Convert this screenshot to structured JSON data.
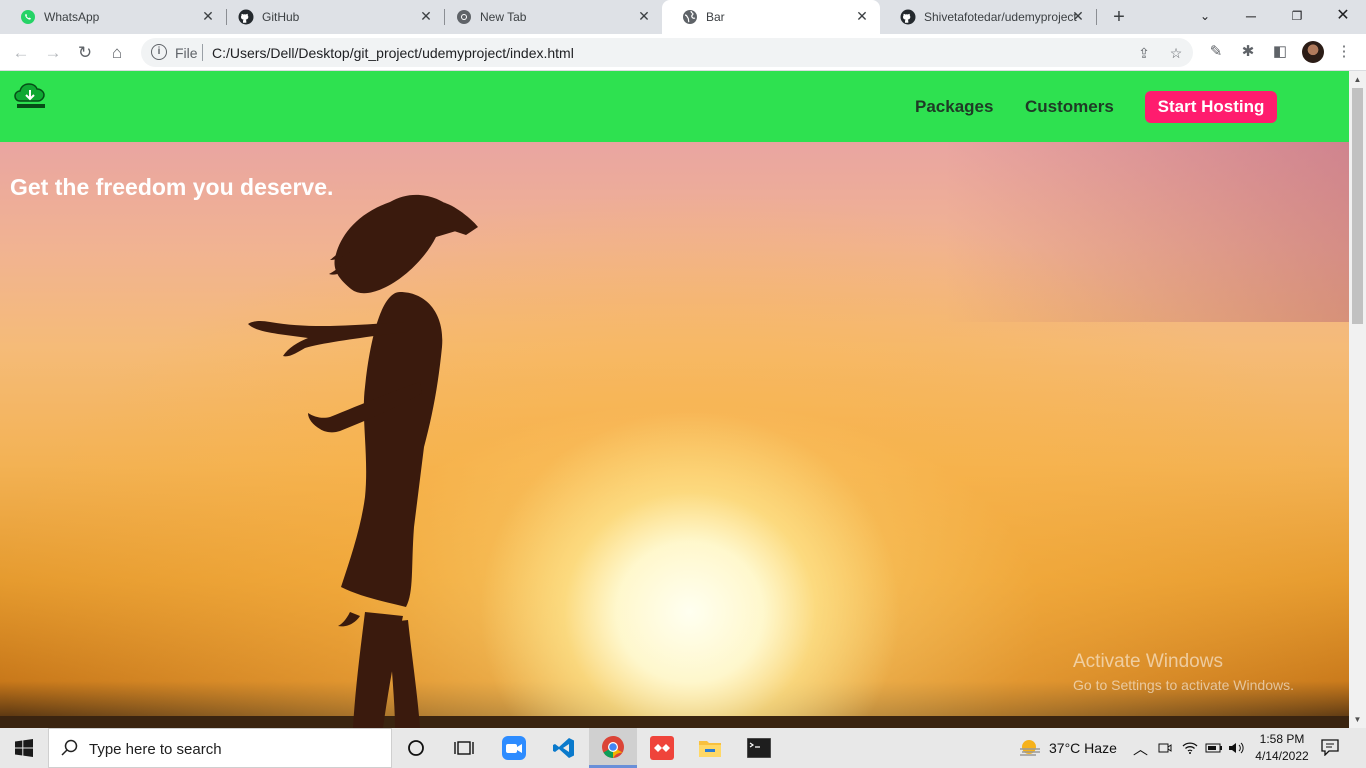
{
  "browser": {
    "tabs": [
      {
        "title": "WhatsApp",
        "icon": "whatsapp-icon",
        "active": false
      },
      {
        "title": "GitHub",
        "icon": "github-icon",
        "active": false
      },
      {
        "title": "New Tab",
        "icon": "chrome-icon",
        "active": false
      },
      {
        "title": "Bar",
        "icon": "globe-icon",
        "active": true
      },
      {
        "title": "Shivetafotedar/udemyproject",
        "icon": "github-icon",
        "active": false
      }
    ],
    "omnibox": {
      "scheme_label": "File",
      "url": "C:/Users/Dell/Desktop/git_project/udemyproject/index.html"
    }
  },
  "site": {
    "nav": {
      "links": [
        "Packages",
        "Customers"
      ],
      "cta_label": "Start Hosting"
    },
    "hero": {
      "headline": "Get the freedom you deserve."
    }
  },
  "watermark": {
    "line1": "Activate Windows",
    "line2": "Go to Settings to activate Windows."
  },
  "taskbar": {
    "search_placeholder": "Type here to search",
    "weather": "37°C  Haze",
    "time": "1:58 PM",
    "date": "4/14/2022"
  },
  "colors": {
    "nav_bg": "#2ee150",
    "cta_bg": "#ff1c6e",
    "tabstrip_bg": "#dee1e6"
  }
}
